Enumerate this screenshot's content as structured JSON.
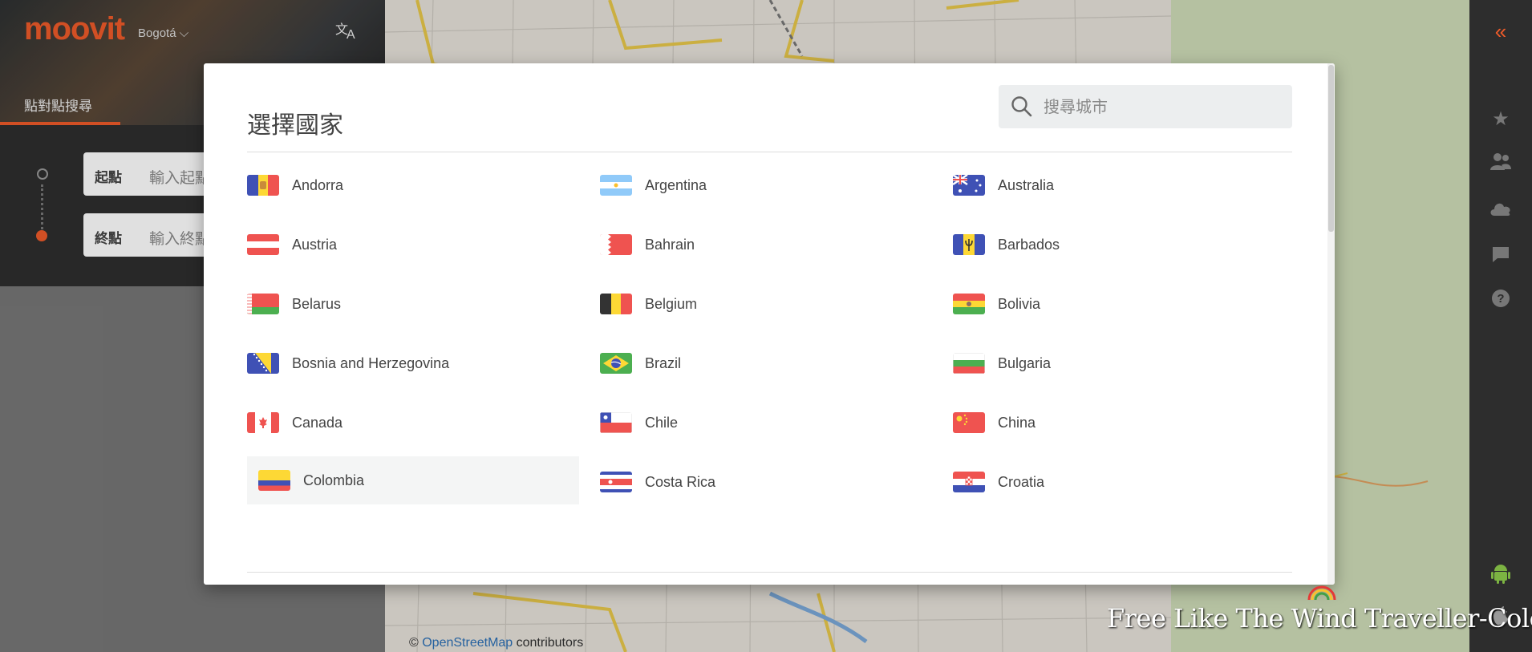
{
  "app": {
    "logo": "moovit",
    "city": "Bogotá",
    "city_chevron": "⌵",
    "language_icon": "translate-icon",
    "tab": "點對點搜尋",
    "from_label": "起點",
    "from_placeholder": "輸入起點",
    "to_label": "終點",
    "to_placeholder": "輸入終點",
    "accent_color": "#ee5b2a"
  },
  "right_sidebar": {
    "icons": [
      "collapse-icon",
      "star-icon",
      "users-icon",
      "cloud-icon",
      "chat-icon",
      "help-icon",
      "android-icon",
      "apple-icon"
    ]
  },
  "modal": {
    "title": "選擇國家",
    "search_placeholder": "搜尋城市",
    "countries": [
      {
        "name": "Andorra",
        "flag": "andorra"
      },
      {
        "name": "Argentina",
        "flag": "argentina"
      },
      {
        "name": "Australia",
        "flag": "australia"
      },
      {
        "name": "Austria",
        "flag": "austria"
      },
      {
        "name": "Bahrain",
        "flag": "bahrain"
      },
      {
        "name": "Barbados",
        "flag": "barbados"
      },
      {
        "name": "Belarus",
        "flag": "belarus"
      },
      {
        "name": "Belgium",
        "flag": "belgium"
      },
      {
        "name": "Bolivia",
        "flag": "bolivia"
      },
      {
        "name": "Bosnia and Herzegovina",
        "flag": "bosnia"
      },
      {
        "name": "Brazil",
        "flag": "brazil"
      },
      {
        "name": "Bulgaria",
        "flag": "bulgaria"
      },
      {
        "name": "Canada",
        "flag": "canada"
      },
      {
        "name": "Chile",
        "flag": "chile"
      },
      {
        "name": "China",
        "flag": "china"
      },
      {
        "name": "Colombia",
        "flag": "colombia",
        "highlighted": true
      },
      {
        "name": "Costa Rica",
        "flag": "costarica"
      },
      {
        "name": "Croatia",
        "flag": "croatia"
      }
    ]
  },
  "map": {
    "attribution_prefix": "© ",
    "attribution_link": "OpenStreetMap",
    "attribution_suffix": " contributors"
  },
  "watermark": "Free Like The Wind Traveller-Colombia"
}
